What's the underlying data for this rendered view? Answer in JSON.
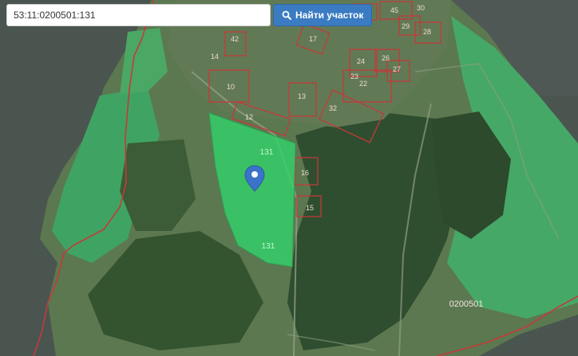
{
  "search": {
    "value": "53:11:0200501:131",
    "button_label": "Найти участок",
    "button_icon": "search-icon"
  },
  "map": {
    "type": "satellite-cadastral",
    "selected_parcel": {
      "id": "131",
      "labels": [
        "131",
        "131"
      ],
      "fill_color": "#33d36a"
    },
    "marker": "map-pin-icon",
    "quarter_label": "0200501",
    "parcel_labels": [
      "21",
      "45",
      "30",
      "29",
      "28",
      "42",
      "17",
      "24",
      "26",
      "27",
      "14",
      "23",
      "10",
      "13",
      "32",
      "22",
      "12",
      "16",
      "15"
    ],
    "colors": {
      "boundary": "#cc3333",
      "land": "#5a7d4f",
      "water": "#4c5550",
      "meadow": "#3fa061",
      "forest": "#2f4f30",
      "marker": "#3a73c7"
    }
  }
}
